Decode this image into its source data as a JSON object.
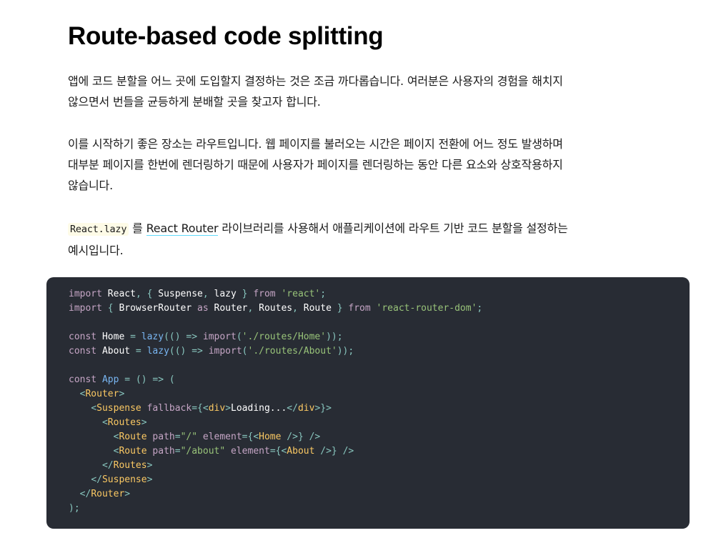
{
  "article": {
    "title": "Route-based code splitting",
    "para1": "앱에 코드 분할을 어느 곳에 도입할지 결정하는 것은 조금 까다롭습니다. 여러분은 사용자의 경험을 해치지 않으면서 번들을 균등하게 분배할 곳을 찾고자 합니다.",
    "para2": "이를 시작하기 좋은 장소는 라우트입니다. 웹 페이지를 불러오는 시간은 페이지 전환에 어느 정도 발생하며 대부분 페이지를 한번에 렌더링하기 때문에 사용자가 페이지를 렌더링하는 동안 다른 요소와 상호작용하지 않습니다.",
    "para3": {
      "code": "React.lazy",
      "text_a": " 를 ",
      "link": "React Router",
      "text_b": " 라이브러리를 사용해서 애플리케이션에 라우트 기반 코드 분할을 설정하는 예시입니다."
    }
  },
  "code": {
    "tokens": {
      "import": "import",
      "from": "from",
      "as": "as",
      "const": "const",
      "React": "React",
      "Suspense": "Suspense",
      "lazy": "lazy",
      "react": "'react'",
      "BrowserRouter": "BrowserRouter",
      "Router": "Router",
      "Routes": "Routes",
      "Route": "Route",
      "rrd": "'react-router-dom'",
      "Home": "Home",
      "About": "About",
      "homePath": "'./routes/Home'",
      "aboutPath": "'./routes/About'",
      "App": "App",
      "fallback": "fallback",
      "div": "div",
      "loading": "Loading...",
      "path": "path",
      "element": "element",
      "slash": "\"/\"",
      "aboutRoute": "\"/about\""
    }
  }
}
